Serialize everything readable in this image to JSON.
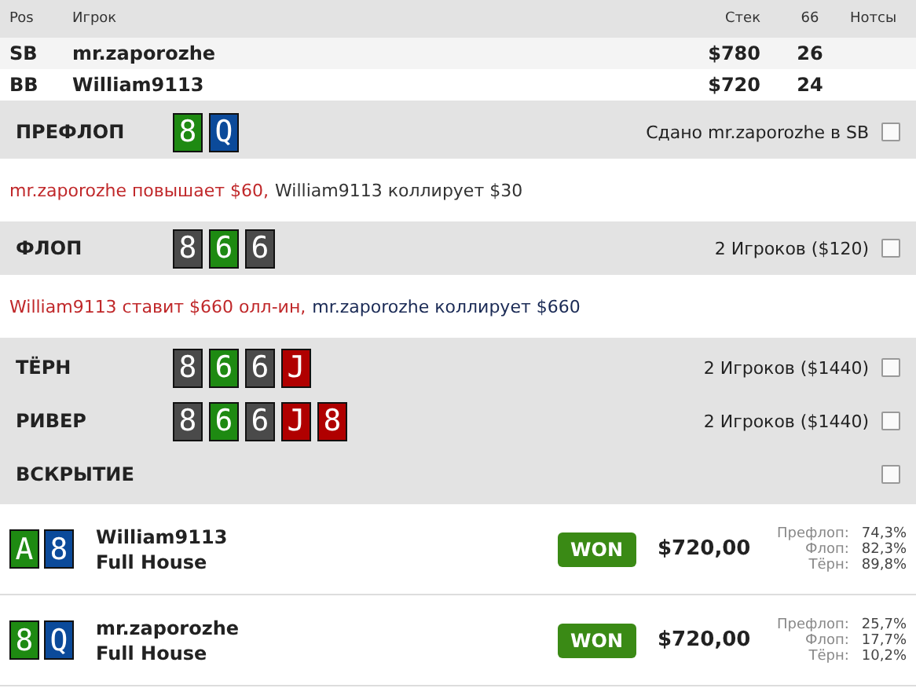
{
  "table": {
    "columns": [
      "Pos",
      "Игрок",
      "Стек",
      "66",
      "Нотсы"
    ],
    "rows": [
      {
        "pos": "SB",
        "player": "mr.zaporozhe",
        "stack": "$780",
        "value": "26"
      },
      {
        "pos": "BB",
        "player": "William9113",
        "stack": "$720",
        "value": "24"
      }
    ]
  },
  "streets": [
    {
      "name": "ПРЕФЛОП",
      "cards": [
        {
          "rank": "8",
          "color": "#1e8a12"
        },
        {
          "rank": "Q",
          "color": "#0b4a9a"
        }
      ],
      "info": "Сдано mr.zaporozhe в SB",
      "checked": false,
      "actions": [
        {
          "text": "mr.zaporozhe повышает $60,",
          "color": "#c0282a"
        },
        {
          "text": "William9113 коллирует $30",
          "color": "#333333"
        }
      ]
    },
    {
      "name": "ФЛОП",
      "cards": [
        {
          "rank": "8",
          "color": "#4a4a4a"
        },
        {
          "rank": "6",
          "color": "#1e8a12"
        },
        {
          "rank": "6",
          "color": "#4a4a4a"
        }
      ],
      "info": "2 Игроков ($120)",
      "checked": false,
      "actions": [
        {
          "text": "William9113 ставит $660 олл-ин,",
          "color": "#c0282a"
        },
        {
          "text": "mr.zaporozhe коллирует $660",
          "color": "#1a2a55"
        }
      ]
    },
    {
      "name": "ТЁРН",
      "cards": [
        {
          "rank": "8",
          "color": "#4a4a4a"
        },
        {
          "rank": "6",
          "color": "#1e8a12"
        },
        {
          "rank": "6",
          "color": "#4a4a4a"
        },
        {
          "rank": "J",
          "color": "#b00000"
        }
      ],
      "info": "2 Игроков ($1440)",
      "checked": false
    },
    {
      "name": "РИВЕР",
      "cards": [
        {
          "rank": "8",
          "color": "#4a4a4a"
        },
        {
          "rank": "6",
          "color": "#1e8a12"
        },
        {
          "rank": "6",
          "color": "#4a4a4a"
        },
        {
          "rank": "J",
          "color": "#b00000"
        },
        {
          "rank": "8",
          "color": "#b00000"
        }
      ],
      "info": "2 Игроков ($1440)",
      "checked": false
    },
    {
      "name": "ВСКРЫТИЕ",
      "checked": false
    }
  ],
  "showdown": [
    {
      "cards": [
        {
          "rank": "A",
          "color": "#1e8a12"
        },
        {
          "rank": "8",
          "color": "#0b4a9a"
        }
      ],
      "player": "William9113",
      "hand": "Full House",
      "result": "WON",
      "amount": "$720,00",
      "equity": [
        {
          "label": "Префлоп:",
          "value": "74,3%"
        },
        {
          "label": "Флоп:",
          "value": "82,3%"
        },
        {
          "label": "Тёрн:",
          "value": "89,8%"
        }
      ]
    },
    {
      "cards": [
        {
          "rank": "8",
          "color": "#1e8a12"
        },
        {
          "rank": "Q",
          "color": "#0b4a9a"
        }
      ],
      "player": "mr.zaporozhe",
      "hand": "Full House",
      "result": "WON",
      "amount": "$720,00",
      "equity": [
        {
          "label": "Префлоп:",
          "value": "25,7%"
        },
        {
          "label": "Флоп:",
          "value": "17,7%"
        },
        {
          "label": "Тёрн:",
          "value": "10,2%"
        }
      ]
    }
  ]
}
